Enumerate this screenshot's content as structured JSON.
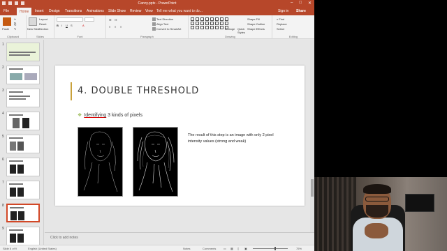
{
  "window": {
    "title": "Canny.pptx - PowerPoint",
    "controls": [
      "–",
      "□",
      "✕"
    ]
  },
  "tabs": [
    {
      "label": "File",
      "active": false
    },
    {
      "label": "Home",
      "active": true
    },
    {
      "label": "Insert",
      "active": false
    },
    {
      "label": "Design",
      "active": false
    },
    {
      "label": "Transitions",
      "active": false
    },
    {
      "label": "Animations",
      "active": false
    },
    {
      "label": "Slide Show",
      "active": false
    },
    {
      "label": "Review",
      "active": false
    },
    {
      "label": "View",
      "active": false
    }
  ],
  "tell_me": "Tell me what you want to do...",
  "sign_in": "Sign in",
  "share": "Share",
  "ribbon": {
    "clipboard": {
      "label": "Clipboard",
      "paste": "Paste"
    },
    "slides": {
      "label": "Slides",
      "new_slide": "New Slide",
      "layout": "Layout",
      "reset": "Reset",
      "section": "Section"
    },
    "font": {
      "label": "Font"
    },
    "paragraph": {
      "label": "Paragraph",
      "text_direction": "Text Direction",
      "align_text": "Align Text",
      "convert_smartart": "Convert to SmartArt"
    },
    "drawing": {
      "label": "Drawing",
      "arrange": "Arrange",
      "quick_styles": "Quick Styles",
      "shape_fill": "Shape Fill",
      "shape_outline": "Shape Outline",
      "shape_effects": "Shape Effects"
    },
    "editing": {
      "label": "Editing",
      "find": "Find",
      "replace": "Replace",
      "select": "Select"
    }
  },
  "thumbnails": [
    {
      "num": "1"
    },
    {
      "num": "2"
    },
    {
      "num": "3"
    },
    {
      "num": "4"
    },
    {
      "num": "5"
    },
    {
      "num": "6"
    },
    {
      "num": "7"
    },
    {
      "num": "8"
    },
    {
      "num": "9"
    }
  ],
  "slide": {
    "title": "4. DOUBLE THRESHOLD",
    "bullet_mark": "❖",
    "bullet_underlined": "Identifying",
    "bullet_rest": " 3 kinds of pixels",
    "description": "The result of this step is an image with only 2 pixel intensity values (strong and weak)"
  },
  "notes_placeholder": "Click to add notes",
  "status": {
    "slide_info": "Slide 8 of 9",
    "language": "English (United States)",
    "notes": "Notes",
    "comments": "Comments",
    "zoom": "75%"
  }
}
